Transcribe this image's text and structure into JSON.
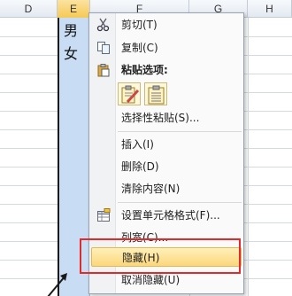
{
  "columns": [
    {
      "letter": "D"
    },
    {
      "letter": "E"
    },
    {
      "letter": "F"
    },
    {
      "letter": "G"
    },
    {
      "letter": "H"
    }
  ],
  "cells": [
    "男",
    "女"
  ],
  "menu": {
    "cut_label": "剪切(T)",
    "copy_label": "复制(C)",
    "paste_options_title": "粘贴选项:",
    "paste_special_label": "选择性粘贴(S)...",
    "insert_label": "插入(I)",
    "delete_label": "删除(D)",
    "clear_label": "清除内容(N)",
    "format_cells_label": "设置单元格格式(F)...",
    "column_width_label": "列宽(C)...",
    "hide_label": "隐藏(H)",
    "unhide_label": "取消隐藏(U)"
  },
  "colors": {
    "selected_column": "#c8dcf3",
    "highlight_item": "#fbd77c",
    "red_box": "#e22a2a"
  }
}
